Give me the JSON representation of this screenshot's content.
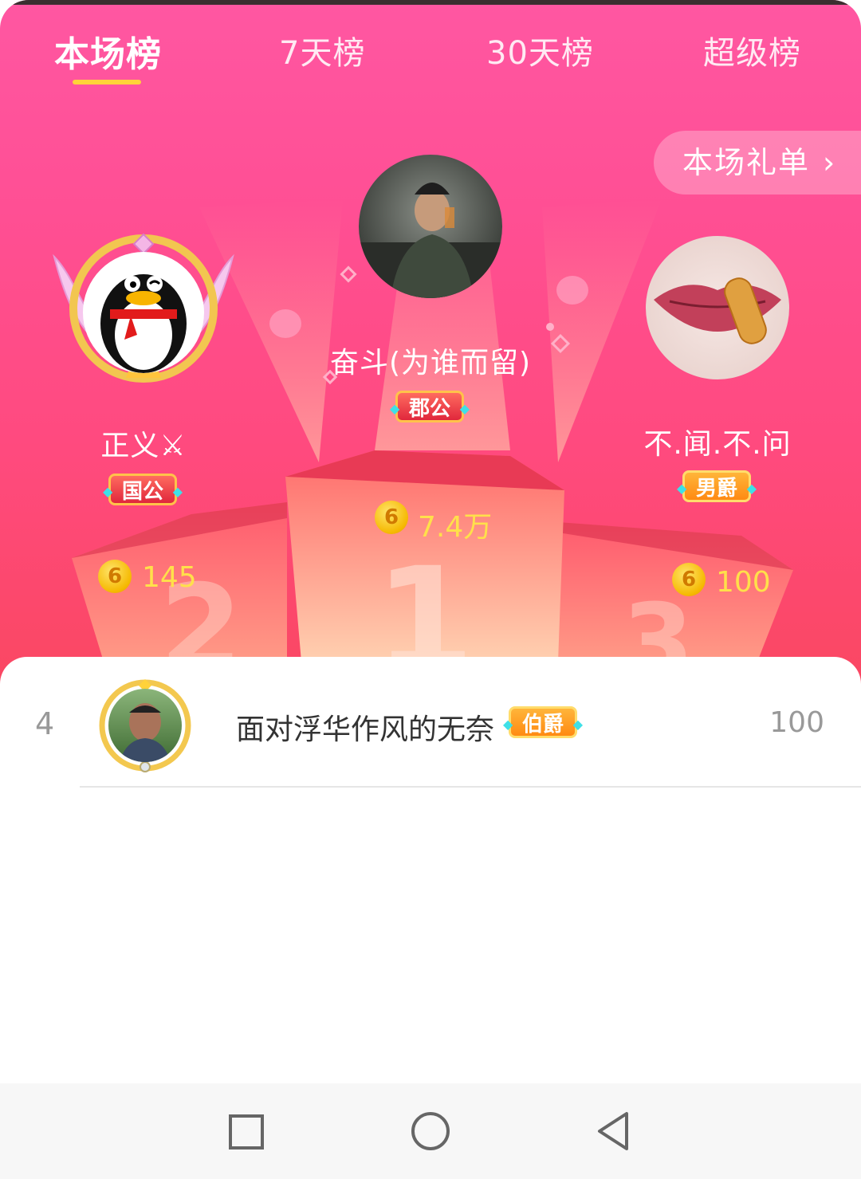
{
  "tabs": [
    {
      "label": "本场榜",
      "active": true
    },
    {
      "label": "7天榜",
      "active": false
    },
    {
      "label": "30天榜",
      "active": false
    },
    {
      "label": "超级榜",
      "active": false
    }
  ],
  "gift_list_button": {
    "label": "本场礼单",
    "icon": "chevron-right-icon"
  },
  "podium": {
    "first": {
      "rank": "1",
      "name": "奋斗(为谁而留)",
      "badge": "郡公",
      "score": "7.4万"
    },
    "second": {
      "rank": "2",
      "name": "正义⚔",
      "badge": "国公",
      "score": "145"
    },
    "third": {
      "rank": "3",
      "name": "不.闻.不.问",
      "badge": "男爵",
      "score": "100"
    }
  },
  "coin_icon_glyph": "6",
  "list": [
    {
      "rank": "4",
      "name": "面对浮华作风的无奈",
      "badge": "伯爵",
      "score": "100"
    }
  ],
  "nav": {
    "recent_icon": "square-icon",
    "home_icon": "circle-icon",
    "back_icon": "triangle-back-icon"
  },
  "colors": {
    "accent": "#ff4f94",
    "tab_underline": "#ffd23a",
    "score": "#ffe04a"
  }
}
